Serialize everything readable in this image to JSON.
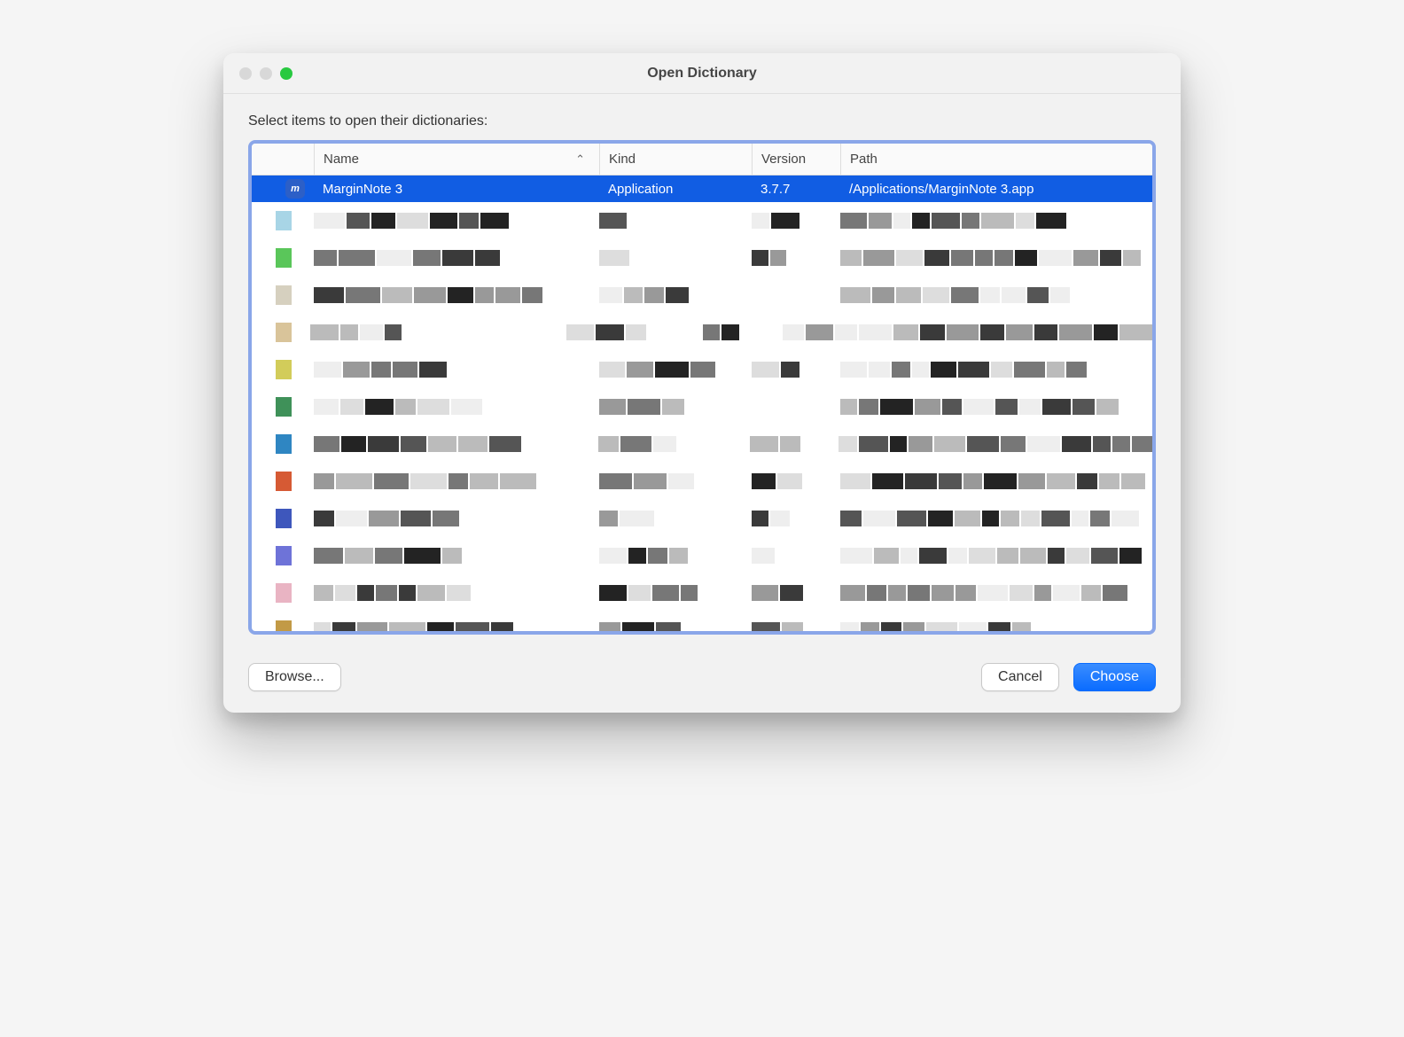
{
  "window": {
    "title": "Open Dictionary"
  },
  "prompt": "Select items to open their dictionaries:",
  "columns": {
    "name": "Name",
    "kind": "Kind",
    "version": "Version",
    "path": "Path",
    "sort_glyph": "⌃"
  },
  "selected_row": {
    "name": "MarginNote 3",
    "kind": "Application",
    "version": "3.7.7",
    "path": "/Applications/MarginNote 3.app",
    "icon_text": "m"
  },
  "other_rows": [
    {
      "swatch": "#a8d5e6"
    },
    {
      "swatch": "#5ac65a"
    },
    {
      "swatch": "#d6d0bf"
    },
    {
      "swatch": "#d9c49a"
    },
    {
      "swatch": "#d2cc5a"
    },
    {
      "swatch": "#3f9159"
    },
    {
      "swatch": "#2f86c2"
    },
    {
      "swatch": "#d65a34"
    },
    {
      "swatch": "#3e57bc"
    },
    {
      "swatch": "#6e73d8"
    },
    {
      "swatch": "#e9b4c3"
    },
    {
      "swatch": "#c29a46"
    },
    {
      "swatch": "#b77fe2"
    },
    {
      "swatch": "#d49a46"
    }
  ],
  "buttons": {
    "browse": "Browse...",
    "cancel": "Cancel",
    "choose": "Choose"
  },
  "colors": {
    "selection": "#115de3",
    "focus_ring": "#8aa6e9"
  }
}
